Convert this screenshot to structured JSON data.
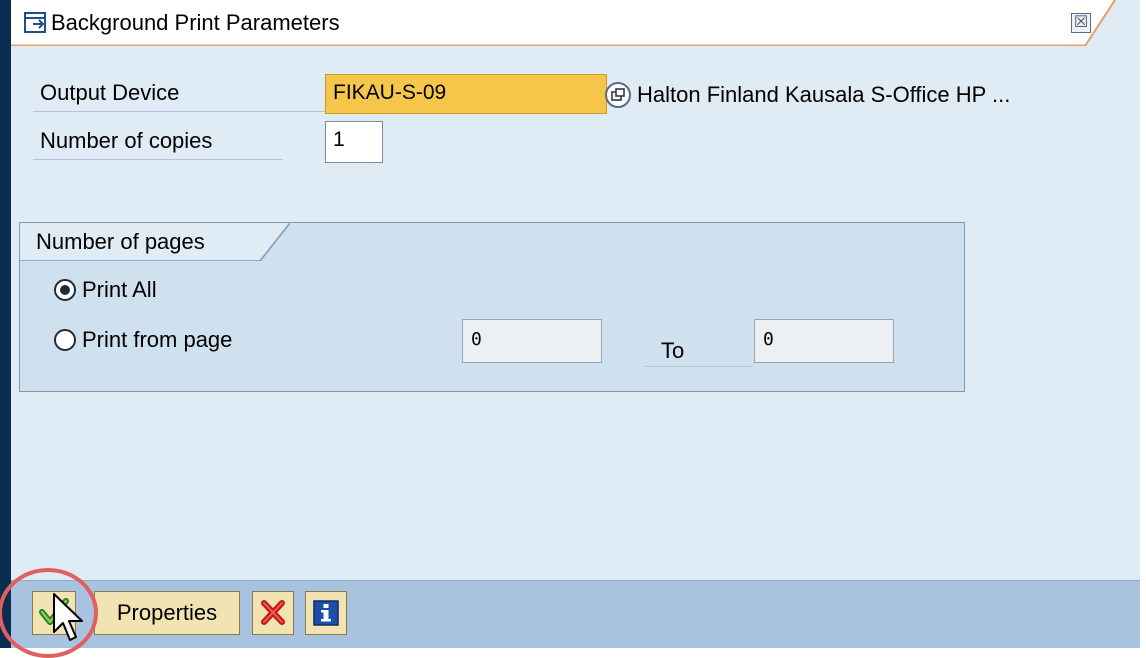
{
  "window": {
    "title": "Background Print Parameters",
    "close_symbol": "☒"
  },
  "output_device": {
    "label": "Output Device",
    "value": "FIKAU-S-09",
    "description": "Halton Finland Kausala S-Office HP ..."
  },
  "copies": {
    "label": "Number of copies",
    "value": "1"
  },
  "pages_group": {
    "title": "Number of pages",
    "print_all_label": "Print All",
    "print_all_selected": true,
    "print_from_label": "Print from page",
    "print_from_selected": false,
    "from_value": "0",
    "to_label": "To",
    "to_value": "0"
  },
  "toolbar": {
    "properties_label": "Properties"
  },
  "icons": {
    "title": "popup-window-icon",
    "matchcode": "possible-entries-icon",
    "ok": "checkmark-icon",
    "cancel": "cancel-x-icon",
    "info": "info-icon"
  },
  "colors": {
    "required_field": "#f5c64a",
    "dialog_bg": "#dfebf5",
    "toolbar_bg": "#a8c3e0",
    "highlight_circle": "#e06060"
  }
}
